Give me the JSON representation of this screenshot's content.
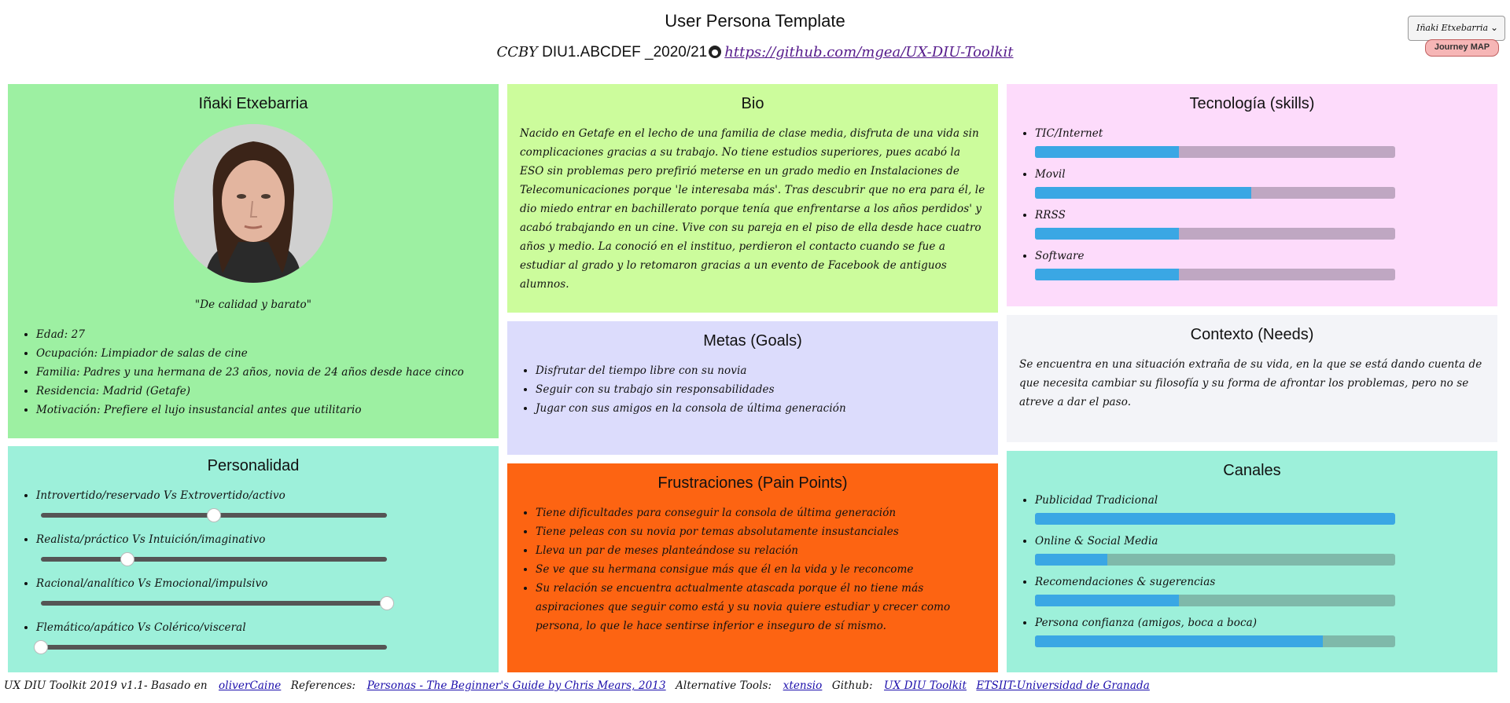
{
  "header": {
    "title": "User Persona Template",
    "license": "CCBY",
    "course": "DIU1.ABCDEF _2020/21",
    "repo_link": "https://github.com/mgea/UX-DIU-Toolkit"
  },
  "persona_select": {
    "value": "Iñaki Etxebarria"
  },
  "journey_button": "Journey MAP",
  "persona": {
    "name": "Iñaki Etxebarria",
    "quote": "\"De calidad y barato\"",
    "facts": [
      "Edad: 27",
      "Ocupación: Limpiador de salas de cine",
      "Familia: Padres y una hermana de 23 años, novia de 24 años desde hace cinco",
      "Residencia: Madrid (Getafe)",
      "Motivación: Prefiere el lujo insustancial antes que utilitario"
    ]
  },
  "personality": {
    "title": "Personalidad",
    "traits": [
      {
        "label": "Introvertido/reservado Vs Extrovertido/activo",
        "value": 0.5
      },
      {
        "label": "Realista/práctico Vs Intuición/imaginativo",
        "value": 0.25
      },
      {
        "label": "Racional/analítico Vs Emocional/impulsivo",
        "value": 1.0
      },
      {
        "label": "Flemático/apático Vs Colérico/visceral",
        "value": 0.0
      }
    ]
  },
  "bio": {
    "title": "Bio",
    "text": "Nacido en Getafe en el lecho de una familia de clase media, disfruta de una vida sin complicaciones gracias a su trabajo. No tiene estudios superiores, pues acabó la ESO sin problemas pero prefirió meterse en un grado medio en Instalaciones de Telecomunicaciones porque 'le interesaba más'. Tras descubrir que no era para él, le dio miedo entrar en bachillerato porque tenía que enfrentarse a los años perdidos' y acabó trabajando en un cine. Vive con su pareja en el piso de ella desde hace cuatro años y medio. La conoció en el instituo, perdieron el contacto cuando se fue a estudiar al grado y lo retomaron gracias a un evento de Facebook de antiguos alumnos."
  },
  "goals": {
    "title": "Metas (Goals)",
    "items": [
      "Disfrutar del tiempo libre con su novia",
      "Seguir con su trabajo sin responsabilidades",
      "Jugar con sus amigos en la consola de última generación"
    ]
  },
  "frustrations": {
    "title": "Frustraciones (Pain Points)",
    "items": [
      "Tiene dificultades para conseguir la consola de última generación",
      "Tiene peleas con su novia por temas absolutamente insustanciales",
      "Lleva un par de meses planteándose su relación",
      "Se ve que su hermana consigue más que él en la vida y le reconcome",
      "Su relación se encuentra actualmente atascada porque él no tiene más aspiraciones que seguir como está y su novia quiere estudiar y crecer como persona, lo que le hace sentirse inferior e inseguro de sí mismo."
    ]
  },
  "tech": {
    "title": "Tecnología (skills)",
    "items": [
      {
        "label": "TIC/Internet",
        "value": 0.4
      },
      {
        "label": "Movil",
        "value": 0.6
      },
      {
        "label": "RRSS",
        "value": 0.4
      },
      {
        "label": "Software",
        "value": 0.4
      }
    ]
  },
  "context": {
    "title": "Contexto (Needs)",
    "text": "Se encuentra en una situación extraña de su vida, en la que se está dando cuenta de que necesita cambiar su filosofía y su forma de afrontar los problemas, pero no se atreve a dar el paso."
  },
  "channels": {
    "title": "Canales",
    "items": [
      {
        "label": "Publicidad Tradicional",
        "value": 1.0
      },
      {
        "label": "Online & Social Media",
        "value": 0.2
      },
      {
        "label": "Recomendaciones & sugerencias",
        "value": 0.4
      },
      {
        "label": "Persona confianza (amigos, boca a boca)",
        "value": 0.8
      }
    ]
  },
  "footer": {
    "credit": "UX DIU Toolkit 2019 v1.1- Basado en",
    "credit_link": "oliverCaine",
    "references_label": "References:",
    "references_link": "Personas - The Beginner's Guide by Chris Mears, 2013",
    "alt_label": "Alternative Tools:",
    "alt_link": "xtensio",
    "github_label": "Github:",
    "github_link": "UX DIU Toolkit",
    "univ_link": "ETSIIT-Universidad de Granada"
  },
  "colors": {
    "persona_bg": "#9df0a2",
    "personality_bg": "#9df0da",
    "bio_bg": "#ccfc9c",
    "goals_bg": "#dcdcfc",
    "frustrations_bg": "#fd6412",
    "tech_bg": "#fddbfb",
    "context_bg": "#f3f4f8",
    "channels_bg": "#9df0da",
    "bar_fill": "#3aa7e4"
  }
}
